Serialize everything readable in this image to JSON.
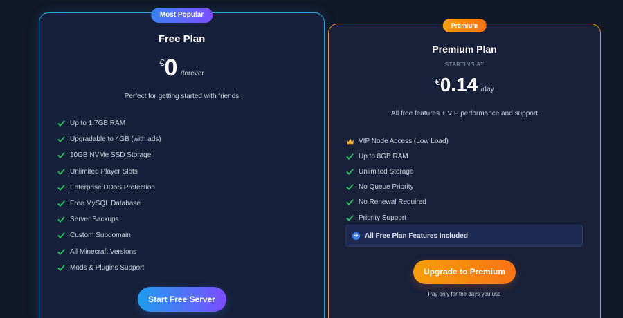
{
  "colors": {
    "background": "#111827",
    "card": "#16203a",
    "free_border": "#1fa8e0",
    "premium_border": "#e8922b",
    "check": "#22c55e",
    "accent_blue": "#3b82f6",
    "accent_purple": "#7c4dff",
    "accent_orange": "#f97316"
  },
  "icons": {
    "check": "check-icon",
    "crown": "crown-icon",
    "plus": "plus-circle-icon"
  },
  "free": {
    "badge": "Most Popular",
    "title": "Free Plan",
    "currency": "€",
    "amount": "0",
    "period": "/forever",
    "description": "Perfect for getting started with friends",
    "features": [
      "Up to 1.7GB RAM",
      "Upgradable to 4GB (with ads)",
      "10GB NVMe SSD Storage",
      "Unlimited Player Slots",
      "Enterprise DDoS Protection",
      "Free MySQL Database",
      "Server Backups",
      "Custom Subdomain",
      "All Minecraft Versions",
      "Mods & Plugins Support"
    ],
    "cta": "Start Free Server"
  },
  "premium": {
    "badge": "Premium",
    "title": "Premium Plan",
    "starting_at": "STARTING AT",
    "currency": "€",
    "amount": "0.14",
    "period": "/day",
    "description": "All free features + VIP performance and support",
    "features": [
      "VIP Node Access (Low Load)",
      "Up to 8GB RAM",
      "Unlimited Storage",
      "No Queue Priority",
      "No Renewal Required",
      "Priority Support"
    ],
    "included": "All Free Plan Features Included",
    "cta": "Upgrade to Premium",
    "footnote": "Pay only for the days you use"
  }
}
